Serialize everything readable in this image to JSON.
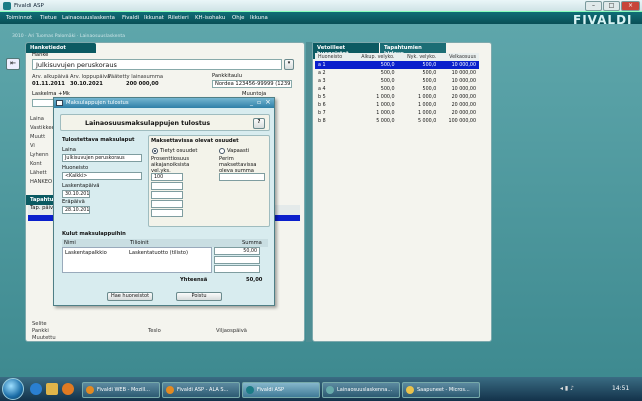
{
  "window": {
    "title": "Fivaldi ASP",
    "brand": "FIVALDI"
  },
  "menu": [
    "Toiminnot",
    "Tietue",
    "Lainaosuuslaskenta",
    "Fivaldi",
    "Ikkunat",
    "Riletieri",
    "KH-isohaku",
    "Ohje",
    "Ikkuna"
  ],
  "breadcrumb": "3010 · Ari Tuomas Palomäki · Lainaosuuslaskenta",
  "left_panel": {
    "tab": "Hanketiedot",
    "subtab": "Hanke",
    "project": "Julkisuvujen peruskoraus",
    "cols": [
      "Arv. alkupäivä",
      "Arv. loppupäivä",
      "Päätetty lainasumma"
    ],
    "vals": [
      "01.11.2011",
      "30.10.2021",
      "200 000,00"
    ],
    "pankki_label": "Pankkitaulu",
    "pankki": "Nordea 123456-99999 (1239...",
    "muuntoja": "Muuntoja",
    "laskelma": "Laskelma +Mk",
    "side_labels": [
      "Laina",
      "Vastikkeet",
      "Muutt",
      "Vi",
      "Lyhenn",
      "Kont",
      "Lähett",
      "HANKEO"
    ],
    "lower_tab": "Tapahtumat",
    "lower_header": "Tap. päivä",
    "footer": [
      "Selite",
      "Pankki",
      "Muutettu",
      "Teslo",
      "Viljaospäivä"
    ]
  },
  "right_panel": {
    "tabs": [
      "Vetoilleet huoneistot",
      "Tapahtumien kirjaus"
    ],
    "headers": [
      "Huoneisto",
      "Alkup. velyko.",
      "Nyk. velyko.",
      "Velkaosuus"
    ],
    "rows": [
      [
        "a 1",
        "500,0",
        "500,0",
        "10 000,00"
      ],
      [
        "a 2",
        "500,0",
        "500,0",
        "10 000,00"
      ],
      [
        "a 3",
        "500,0",
        "500,0",
        "10 000,00"
      ],
      [
        "a 4",
        "500,0",
        "500,0",
        "10 000,00"
      ],
      [
        "b 5",
        "1 000,0",
        "1 000,0",
        "20 000,00"
      ],
      [
        "b 6",
        "1 000,0",
        "1 000,0",
        "20 000,00"
      ],
      [
        "b 7",
        "1 000,0",
        "1 000,0",
        "20 000,00"
      ],
      [
        "b 8",
        "5 000,0",
        "5 000,0",
        "100 000,00"
      ]
    ]
  },
  "dialog": {
    "title": "Maksulappujen tulostus",
    "heading": "Lainaosuusmaksulappujen tulostus",
    "help": "?",
    "left_section": "Tulostettava maksulaput",
    "laina_label": "Laina",
    "laina_value": "Julkisuvujen peruskoraus",
    "huoneisto_label": "Huoneisto",
    "huoneisto_value": "<Kaikki>",
    "laskentapaiva_label": "Laskentapäivä",
    "laskentapaiva": "30.10.2011",
    "erapaiva_label": "Eräpäivä",
    "erapaiva": "28.10.2011",
    "right_section": "Maksettavissa olevat osuudet",
    "opt_tietyt": "Tietyt osuudet",
    "opt_vapaasti": "Vapaasti",
    "prosentti_label": "Prosenttiosuus aikajanoiksista vel.yks.",
    "prosentti_value": "100",
    "perim_label": "Perim maksettavissa oleva summa",
    "kulut_section": "Kulut maksulappuihin",
    "kulut_headers": [
      "Nimi",
      "Tilioinit",
      "Summa"
    ],
    "kulut_row": [
      "Laskentapalkkio",
      "Laskentatuotto (tilisto)",
      "50,00"
    ],
    "yhteensa_label": "Yhteensä",
    "yhteensa_value": "50,00",
    "btn_hae": "Hae huoneistot",
    "btn_poistu": "Poistu"
  },
  "taskbar": {
    "items": [
      "Fivaldi WEB - Mozill...",
      "Fivaldi ASP - ALA S...",
      "Fivaldi ASP",
      "Lainaosuuslaskenna...",
      "Saapuneet - Micros..."
    ],
    "time": "14:51"
  }
}
